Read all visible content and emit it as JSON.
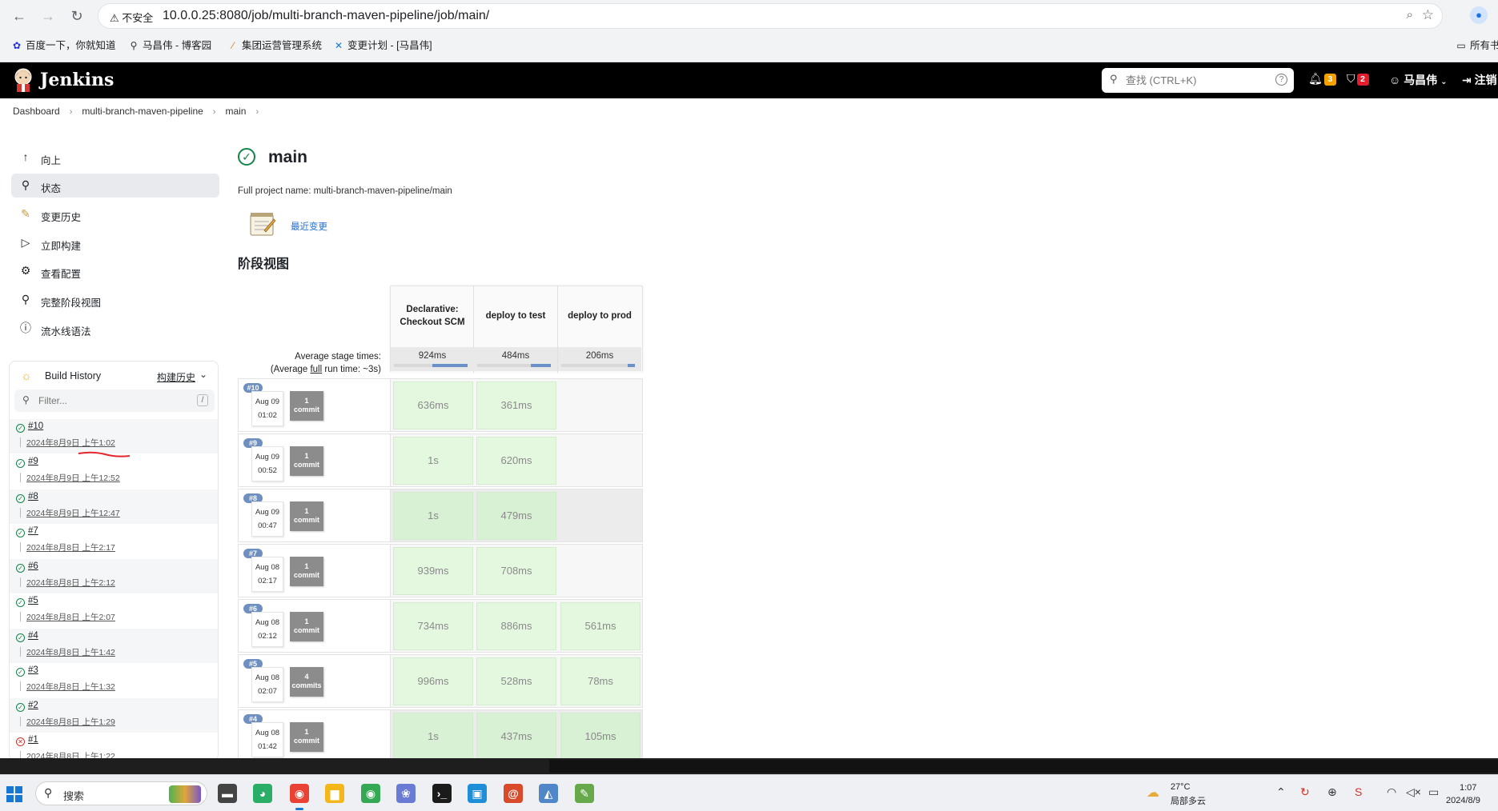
{
  "browser": {
    "security_label": "不安全",
    "url": "10.0.0.25:8080/job/multi-branch-maven-pipeline/job/main/",
    "bookmarks": [
      "百度一下，你就知道",
      "马昌伟 - 博客园",
      "集团运营管理系统",
      "变更计划 - [马昌伟]"
    ],
    "bookmarks_right": "所有书"
  },
  "header": {
    "title": "Jenkins",
    "search_placeholder": "查找 (CTRL+K)",
    "notifications_count": "3",
    "security_count": "2",
    "user": "马昌伟",
    "logout": "注销"
  },
  "breadcrumb": [
    "Dashboard",
    "multi-branch-maven-pipeline",
    "main"
  ],
  "sidebar": {
    "tasks": [
      {
        "icon": "arrow-up-icon",
        "label": "向上"
      },
      {
        "icon": "search-icon",
        "label": "状态"
      },
      {
        "icon": "notepad-icon",
        "label": "变更历史"
      },
      {
        "icon": "play-icon",
        "label": "立即构建"
      },
      {
        "icon": "gear-icon",
        "label": "查看配置"
      },
      {
        "icon": "search-icon",
        "label": "完整阶段视图"
      },
      {
        "icon": "help-icon",
        "label": "流水线语法"
      }
    ],
    "build_history": {
      "title": "Build History",
      "trend_label": "构建历史",
      "filter_placeholder": "Filter...",
      "builds": [
        {
          "num": "#10",
          "date": "2024年8月9日 上午1:02",
          "status": "success"
        },
        {
          "num": "#9",
          "date": "2024年8月9日 上午12:52",
          "status": "success"
        },
        {
          "num": "#8",
          "date": "2024年8月9日 上午12:47",
          "status": "success"
        },
        {
          "num": "#7",
          "date": "2024年8月8日 上午2:17",
          "status": "success"
        },
        {
          "num": "#6",
          "date": "2024年8月8日 上午2:12",
          "status": "success"
        },
        {
          "num": "#5",
          "date": "2024年8月8日 上午2:07",
          "status": "success"
        },
        {
          "num": "#4",
          "date": "2024年8月8日 上午1:42",
          "status": "success"
        },
        {
          "num": "#3",
          "date": "2024年8月8日 上午1:32",
          "status": "success"
        },
        {
          "num": "#2",
          "date": "2024年8月8日 上午1:29",
          "status": "success"
        },
        {
          "num": "#1",
          "date": "2024年8月8日 上午1:22",
          "status": "failed"
        }
      ]
    }
  },
  "main": {
    "title": "main",
    "full_name_label": "Full project name: multi-branch-maven-pipeline/main",
    "recent_changes": "最近变更",
    "stage_view_title": "阶段视图",
    "avg_label_line1": "Average stage times:",
    "avg_label_pre": "(Average ",
    "avg_label_full": "full",
    "avg_label_post": " run time: ~3s)",
    "stages": [
      {
        "name": "Declarative: Checkout SCM",
        "avg": "924ms",
        "avg_fraction": 0.48
      },
      {
        "name": "deploy to test",
        "avg": "484ms",
        "avg_fraction": 0.27
      },
      {
        "name": "deploy to prod",
        "avg": "206ms",
        "avg_fraction": 0.1
      }
    ],
    "runs": [
      {
        "num": "#10",
        "month": "Aug 09",
        "time": "01:02",
        "commits": "1",
        "commit_label": "commit",
        "cells": [
          "636ms",
          "361ms",
          ""
        ]
      },
      {
        "num": "#9",
        "month": "Aug 09",
        "time": "00:52",
        "commits": "1",
        "commit_label": "commit",
        "cells": [
          "1s",
          "620ms",
          ""
        ]
      },
      {
        "num": "#8",
        "month": "Aug 09",
        "time": "00:47",
        "commits": "1",
        "commit_label": "commit",
        "cells": [
          "1s",
          "479ms",
          ""
        ]
      },
      {
        "num": "#7",
        "month": "Aug 08",
        "time": "02:17",
        "commits": "1",
        "commit_label": "commit",
        "cells": [
          "939ms",
          "708ms",
          ""
        ]
      },
      {
        "num": "#6",
        "month": "Aug 08",
        "time": "02:12",
        "commits": "1",
        "commit_label": "commit",
        "cells": [
          "734ms",
          "886ms",
          "561ms"
        ]
      },
      {
        "num": "#5",
        "month": "Aug 08",
        "time": "02:07",
        "commits": "4",
        "commit_label": "commits",
        "cells": [
          "996ms",
          "528ms",
          "78ms"
        ]
      },
      {
        "num": "#4",
        "month": "Aug 08",
        "time": "01:42",
        "commits": "1",
        "commit_label": "commit",
        "cells": [
          "1s",
          "437ms",
          "105ms"
        ]
      }
    ]
  },
  "taskbar": {
    "search_label": "搜索",
    "weather_temp": "27°C",
    "weather_desc": "局部多云",
    "time": "1:07",
    "date": "2024/8/9"
  }
}
